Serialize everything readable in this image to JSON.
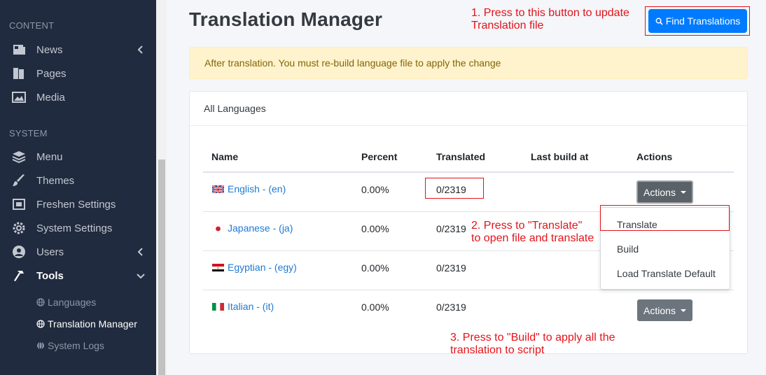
{
  "sidebar": {
    "content_label": "CONTENT",
    "system_label": "SYSTEM",
    "content_items": [
      {
        "label": "News",
        "icon": "newspaper-icon"
      },
      {
        "label": "Pages",
        "icon": "book-icon"
      },
      {
        "label": "Media",
        "icon": "image-icon"
      }
    ],
    "system_items": [
      {
        "label": "Menu",
        "icon": "layers-icon"
      },
      {
        "label": "Themes",
        "icon": "paint-brush-icon"
      },
      {
        "label": "Freshen Settings",
        "icon": "crop-icon"
      },
      {
        "label": "System Settings",
        "icon": "cog-icon"
      },
      {
        "label": "Users",
        "icon": "users-icon"
      },
      {
        "label": "Tools",
        "icon": "hammer-icon"
      }
    ],
    "tools_sub": [
      {
        "label": "Languages",
        "icon": "globe-icon"
      },
      {
        "label": "Translation Manager",
        "icon": "globe-icon"
      },
      {
        "label": "System Logs",
        "icon": "globe-icon"
      }
    ]
  },
  "page": {
    "title": "Translation Manager",
    "find_button": "Find Translations",
    "alert": "After translation. You must re-build language file to apply the change",
    "card_header": "All Languages"
  },
  "table": {
    "headers": [
      "Name",
      "Percent",
      "Translated",
      "Last build at",
      "Actions"
    ],
    "rows": [
      {
        "name": "English - (en)",
        "percent": "0.00%",
        "translated": "0/2319",
        "last_build": "",
        "flag": "uk"
      },
      {
        "name": "Japanese - (ja)",
        "percent": "0.00%",
        "translated": "0/2319",
        "last_build": "",
        "flag": "jp"
      },
      {
        "name": "Egyptian - (egy)",
        "percent": "0.00%",
        "translated": "0/2319",
        "last_build": "",
        "flag": "eg"
      },
      {
        "name": "Italian - (it)",
        "percent": "0.00%",
        "translated": "0/2319",
        "last_build": "",
        "flag": "it"
      }
    ],
    "actions_label": "Actions"
  },
  "dropdown": {
    "items": [
      "Translate",
      "Build",
      "Load Translate Default"
    ]
  },
  "annotations": {
    "note1": [
      "1. Press to this button to update",
      "Translation file"
    ],
    "note2": [
      "2. Press to \"Translate\"",
      "to open file and translate"
    ],
    "note3": [
      "3. Press to \"Build\" to apply all the",
      "translation to script"
    ]
  },
  "colors": {
    "sidebar_bg": "#212b3f",
    "primary": "#007bff",
    "annotation_red": "#e3131b",
    "link": "#1f7ad3"
  }
}
